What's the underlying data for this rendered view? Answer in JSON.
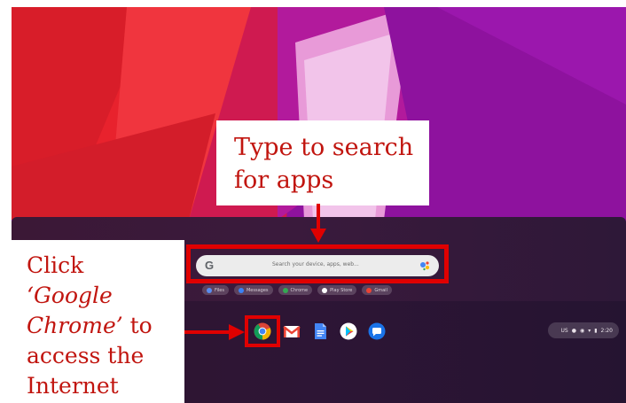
{
  "callouts": {
    "search": {
      "line1": "Type to search",
      "line2": "for apps"
    },
    "chrome": {
      "line1": "Click",
      "line2": "‘Google",
      "line3_italic": "Chrome’",
      "line3_rest": " to",
      "line4": "access the",
      "line5": "Internet"
    }
  },
  "launcher": {
    "search_logo": "G",
    "search_placeholder": "Search your device, apps, web...",
    "assistant_icon": "google-assistant-icon",
    "chips": [
      {
        "label": "Files",
        "icon": "files-icon",
        "color": "#5a8cf0"
      },
      {
        "label": "Messages",
        "icon": "messages-icon",
        "color": "#3b82f6"
      },
      {
        "label": "Chrome",
        "icon": "chrome-icon",
        "color": "#34a853"
      },
      {
        "label": "Play Store",
        "icon": "play-store-icon",
        "color": "#ffffff"
      },
      {
        "label": "Gmail",
        "icon": "gmail-icon",
        "color": "#ea4335"
      }
    ]
  },
  "shelf": {
    "apps": [
      "chrome-icon",
      "gmail-icon",
      "docs-icon",
      "play-store-icon",
      "messages-icon"
    ]
  },
  "status_tray": {
    "locale": "US",
    "time": "2:20",
    "icons": [
      "microphone-icon",
      "notification-icon",
      "wifi-icon",
      "battery-icon"
    ]
  },
  "colors": {
    "annotation_red": "#e00000",
    "callout_text": "#c1150f",
    "wallpaper_red": "#e8232e",
    "wallpaper_purple": "#8e129e"
  }
}
